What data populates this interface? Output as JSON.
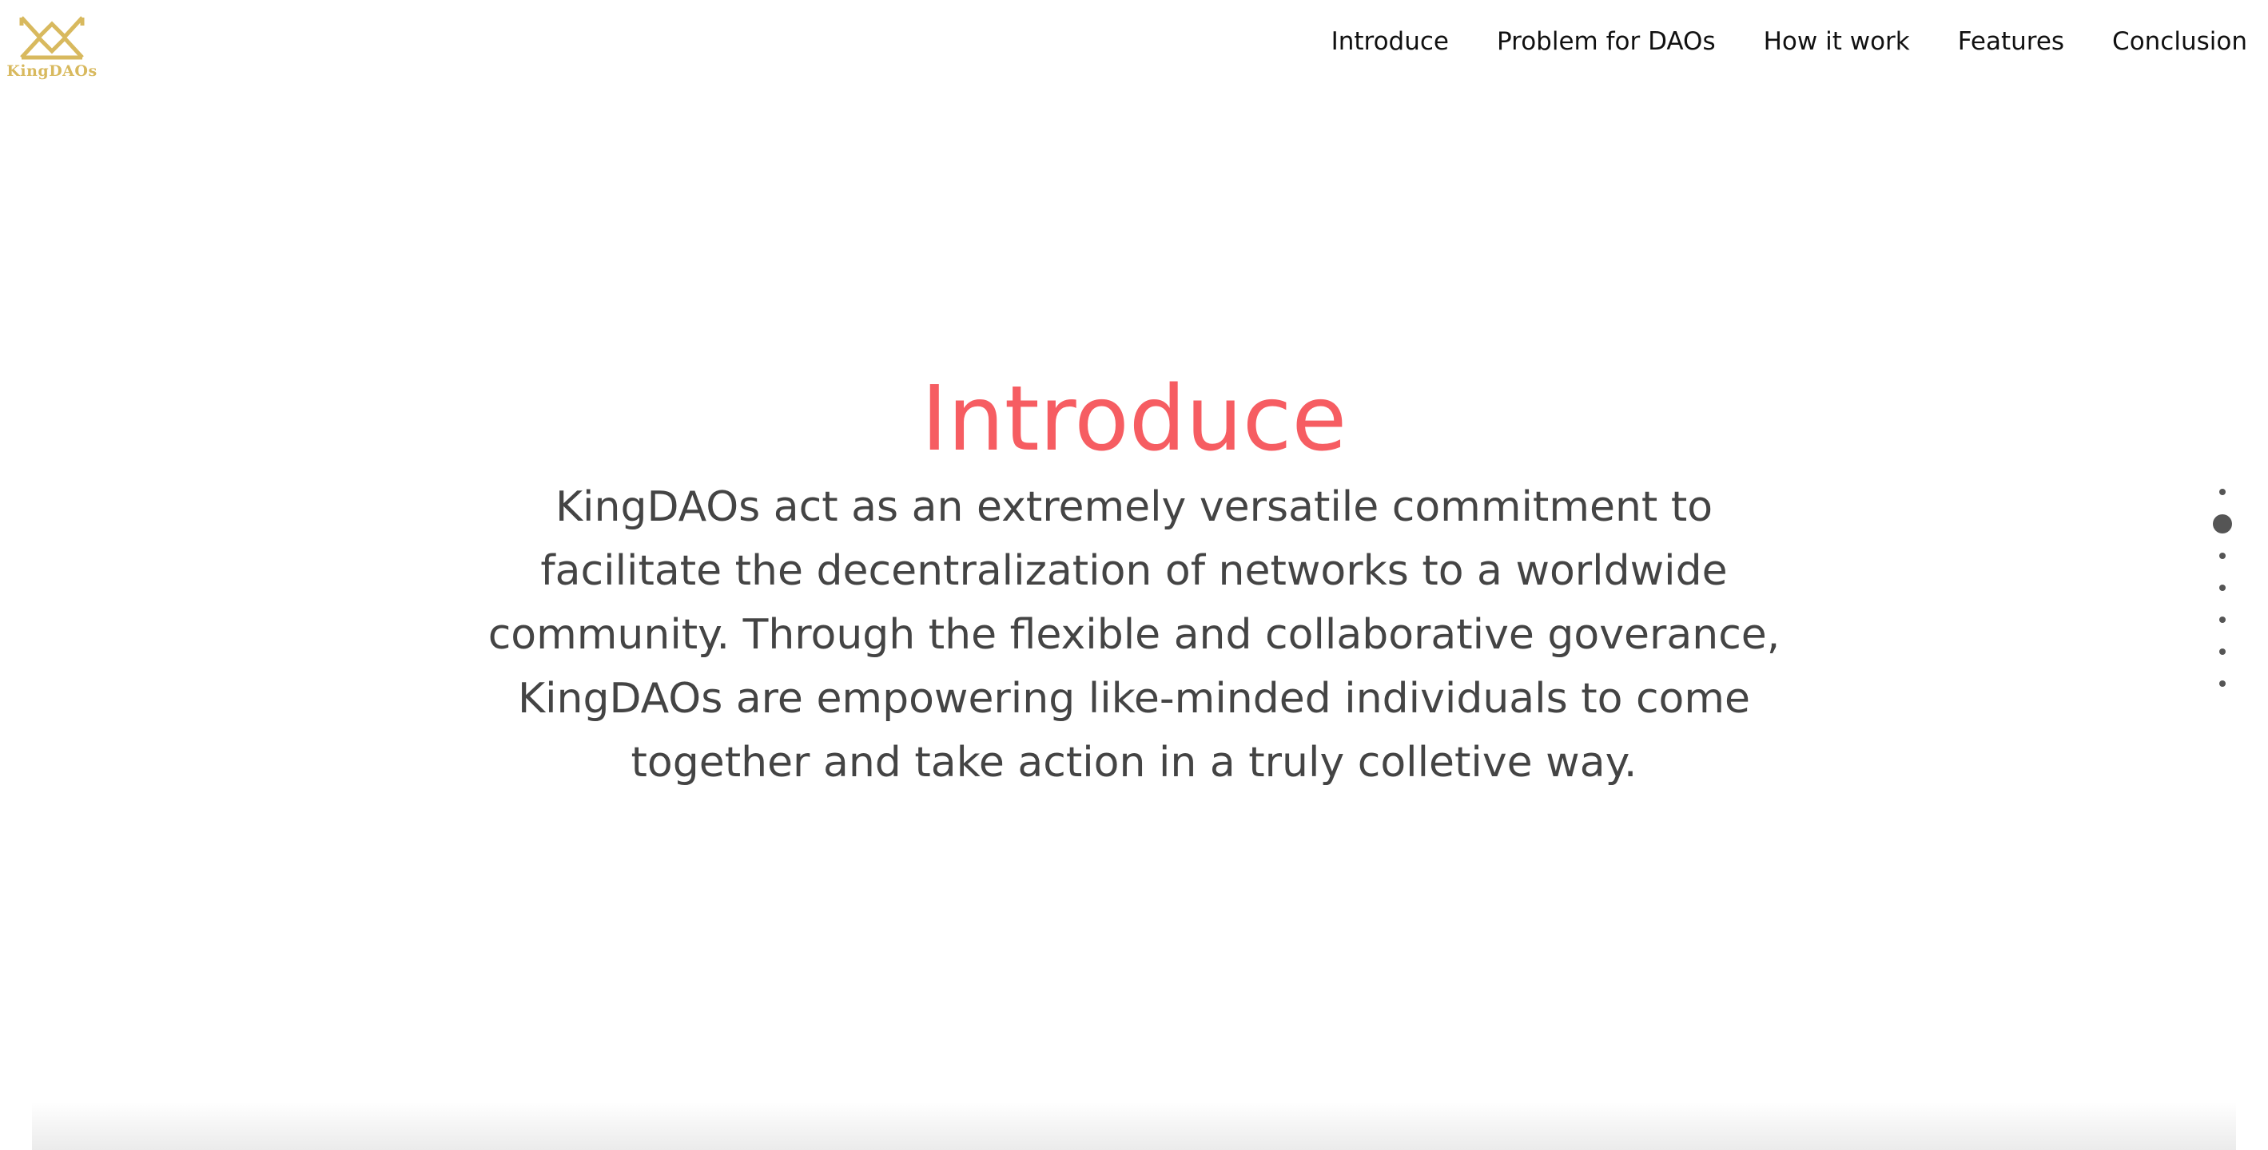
{
  "brand": {
    "name": "KingDAOs",
    "color": "#D8B95E"
  },
  "nav": {
    "items": [
      {
        "label": "Introduce"
      },
      {
        "label": "Problem for DAOs"
      },
      {
        "label": "How it work"
      },
      {
        "label": "Features"
      },
      {
        "label": "Conclusion"
      }
    ]
  },
  "hero": {
    "title": "Introduce",
    "title_color": "#F65D62",
    "lines": [
      "KingDAOs act as an extremely versatile commitment to",
      "facilitate the decentralization of networks to a worldwide",
      "community. Through the flexible and collaborative goverance,",
      "KingDAOs are empowering like-minded individuals to come",
      "together and take action in a truly colletive way."
    ]
  },
  "pagination": {
    "count": 7,
    "active_index": 1
  }
}
